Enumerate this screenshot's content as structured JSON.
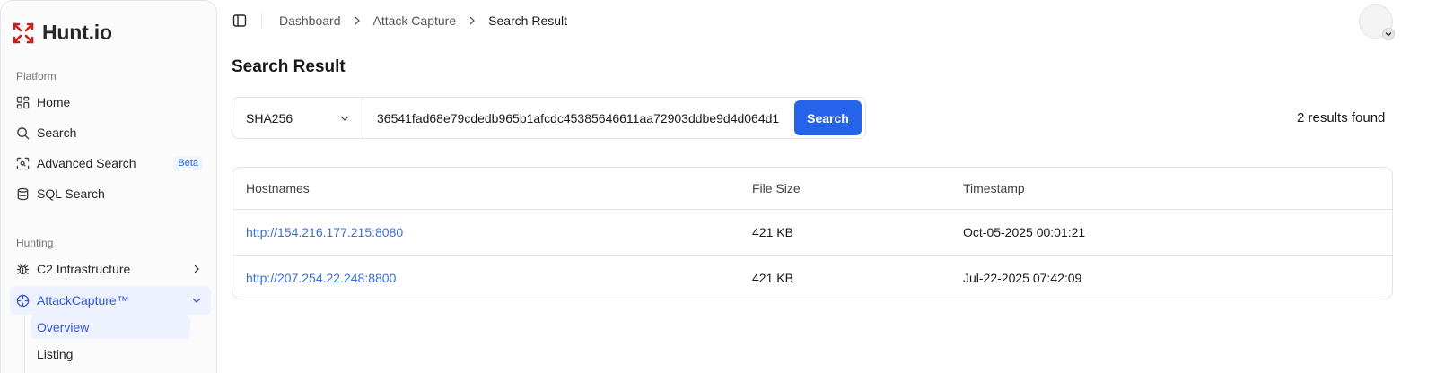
{
  "brand": {
    "name": "Hunt.io",
    "accent": "#c81e1e"
  },
  "sidebar": {
    "platform_label": "Platform",
    "hunting_label": "Hunting",
    "items": [
      {
        "label": "Home",
        "icon": "dashboard-icon"
      },
      {
        "label": "Search",
        "icon": "search-icon"
      },
      {
        "label": "Advanced Search",
        "icon": "scan-icon",
        "badge": "Beta"
      },
      {
        "label": "SQL Search",
        "icon": "database-icon"
      },
      {
        "label": "C2 Infrastructure",
        "icon": "bug-icon"
      },
      {
        "label": "AttackCapture™",
        "icon": "crosshair-icon"
      }
    ],
    "subitems": [
      {
        "label": "Overview"
      },
      {
        "label": "Listing"
      }
    ]
  },
  "breadcrumb": [
    "Dashboard",
    "Attack Capture",
    "Search Result"
  ],
  "page": {
    "title": "Search Result"
  },
  "search": {
    "type": "SHA256",
    "value": "36541fad68e79cdedb965b1afcdc45385646611aa72903ddbe9d4d064d1",
    "button_label": "Search"
  },
  "results": {
    "count_text": "2 results found"
  },
  "table": {
    "headers": [
      "Hostnames",
      "File Size",
      "Timestamp"
    ],
    "rows": [
      {
        "host": "http://154.216.177.215:8080",
        "size": "421 KB",
        "timestamp": "Oct-05-2025 00:01:21"
      },
      {
        "host": "http://207.254.22.248:8800",
        "size": "421 KB",
        "timestamp": "Jul-22-2025 07:42:09"
      }
    ]
  },
  "colors": {
    "primary": "#2563eb",
    "link": "#3b6fd8",
    "active_bg": "#eef2ff"
  }
}
